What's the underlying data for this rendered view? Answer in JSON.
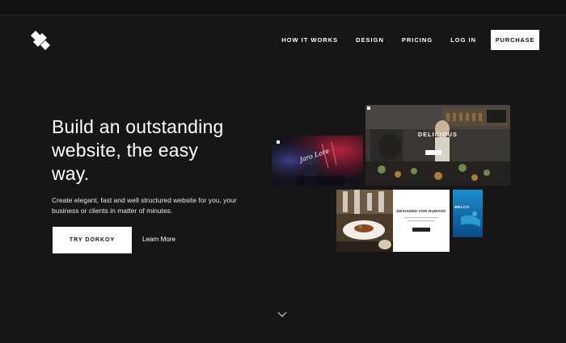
{
  "nav": {
    "links": [
      "HOW IT WORKS",
      "DESIGN",
      "PRICING",
      "LOG IN"
    ],
    "purchase_label": "PURCHASE"
  },
  "hero": {
    "heading_lines": [
      "Build an outstanding",
      "website, the easy",
      "way."
    ],
    "subtext_lines": [
      "Create elegant, fast and well structured website for you, your",
      "business or clients in matter of minutes."
    ],
    "cta_label": "TRY DORKOY",
    "secondary_link": "Learn More"
  },
  "previews": {
    "restaurant_title": "DELICIOUS",
    "concert_lettering": "Jaro Lore",
    "designed_title": "DESIGNED FOR HUMANS",
    "ocean_label": "WELCO"
  },
  "colors": {
    "background": "#161616",
    "text": "#ffffff",
    "button_bg": "#ffffff",
    "button_text": "#111111"
  },
  "icons": {
    "logo": "slashes-logo-icon",
    "scroll": "chevron-down-icon"
  }
}
